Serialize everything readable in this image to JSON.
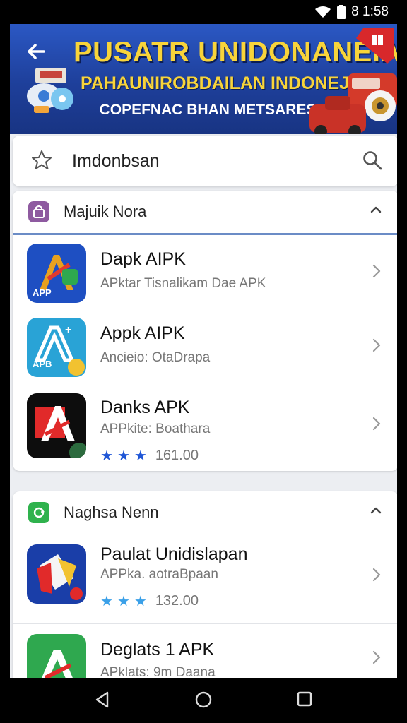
{
  "status_bar": {
    "time": "8 1:58",
    "wifi_icon": "wifi-icon",
    "battery_icon": "battery-icon"
  },
  "banner": {
    "title": "PUSATR UNIDONANEIA",
    "subtitle": "PAHAUNIROBDAILAN INDONEJIA",
    "tagline": "COPEFNAC BHAN METSARES",
    "colors": {
      "bg": "#2552bd",
      "title": "#f8d43a"
    }
  },
  "search": {
    "value": "Imdonbsan",
    "star_icon": "star-outline-icon",
    "search_icon": "search-icon"
  },
  "sections": [
    {
      "title": "Majuik Nora",
      "icon_color": "#8e5aa0",
      "apps": [
        {
          "name": "Dapk AIPK",
          "subtitle": "APktar Tisnalikam Dae APK"
        },
        {
          "name": "Appk AIPK",
          "subtitle": "Ancieio: OtaDrapa"
        },
        {
          "name": "Danks APK",
          "subtitle": "APPkite: Boathara",
          "stars": 3,
          "rating_text": "161.00"
        }
      ]
    },
    {
      "title": "Naghsa Nenn",
      "icon_color": "#2fb24d",
      "apps": [
        {
          "name": "Paulat Unidislapan",
          "subtitle": "APPka. aotraBpaan",
          "stars": 3,
          "rating_text": "132.00"
        },
        {
          "name": "Deglats 1 APK",
          "subtitle": "APklats: 9m Daana"
        }
      ]
    }
  ],
  "app_icon_labels": {
    "apk": "APP",
    "apk2": "APB"
  },
  "navbar": {
    "back_icon": "nav-back-icon",
    "home_icon": "nav-home-icon",
    "recents_icon": "nav-recents-icon"
  }
}
